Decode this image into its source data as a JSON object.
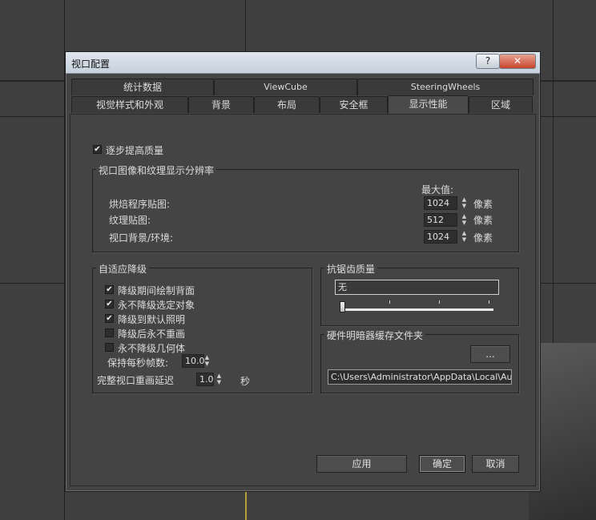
{
  "window": {
    "title": "视口配置",
    "help_label": "?",
    "close_label": "✕"
  },
  "tabs_row1": [
    {
      "label": "统计数据"
    },
    {
      "label": "ViewCube"
    },
    {
      "label": "SteeringWheels"
    }
  ],
  "tabs_row2": [
    {
      "label": "视觉样式和外观"
    },
    {
      "label": "背景"
    },
    {
      "label": "布局"
    },
    {
      "label": "安全框"
    },
    {
      "label": "显示性能",
      "active": true
    },
    {
      "label": "区域"
    }
  ],
  "progressive": {
    "label": "逐步提高质量",
    "checked": true
  },
  "resolution": {
    "title": "视口图像和纹理显示分辨率",
    "max_label": "最大值:",
    "unit": "像素",
    "rows": [
      {
        "label": "烘焙程序贴图:",
        "value": "1024"
      },
      {
        "label": "纹理贴图:",
        "value": "512"
      },
      {
        "label": "视口背景/环境:",
        "value": "1024"
      }
    ]
  },
  "degradation": {
    "title": "自适应降级",
    "options": [
      {
        "label": "降级期间绘制背面",
        "checked": true
      },
      {
        "label": "永不降级选定对象",
        "checked": true
      },
      {
        "label": "降级到默认照明",
        "checked": true
      },
      {
        "label": "降级后永不重画",
        "checked": false
      },
      {
        "label": "永不降级几何体",
        "checked": false
      }
    ],
    "fps_label": "保持每秒帧数:",
    "fps_value": "10.0",
    "delay_label": "完整视口重画延迟",
    "delay_value": "1.0",
    "delay_unit": "秒"
  },
  "antialias": {
    "title": "抗锯齿质量",
    "value": "无",
    "slider_level": 0
  },
  "shader_cache": {
    "title": "硬件明暗器缓存文件夹",
    "browse_label": "...",
    "path": "C:\\Users\\Administrator\\AppData\\Local\\Autodesk"
  },
  "buttons": {
    "apply": "应用",
    "ok": "确定",
    "cancel": "取消"
  }
}
